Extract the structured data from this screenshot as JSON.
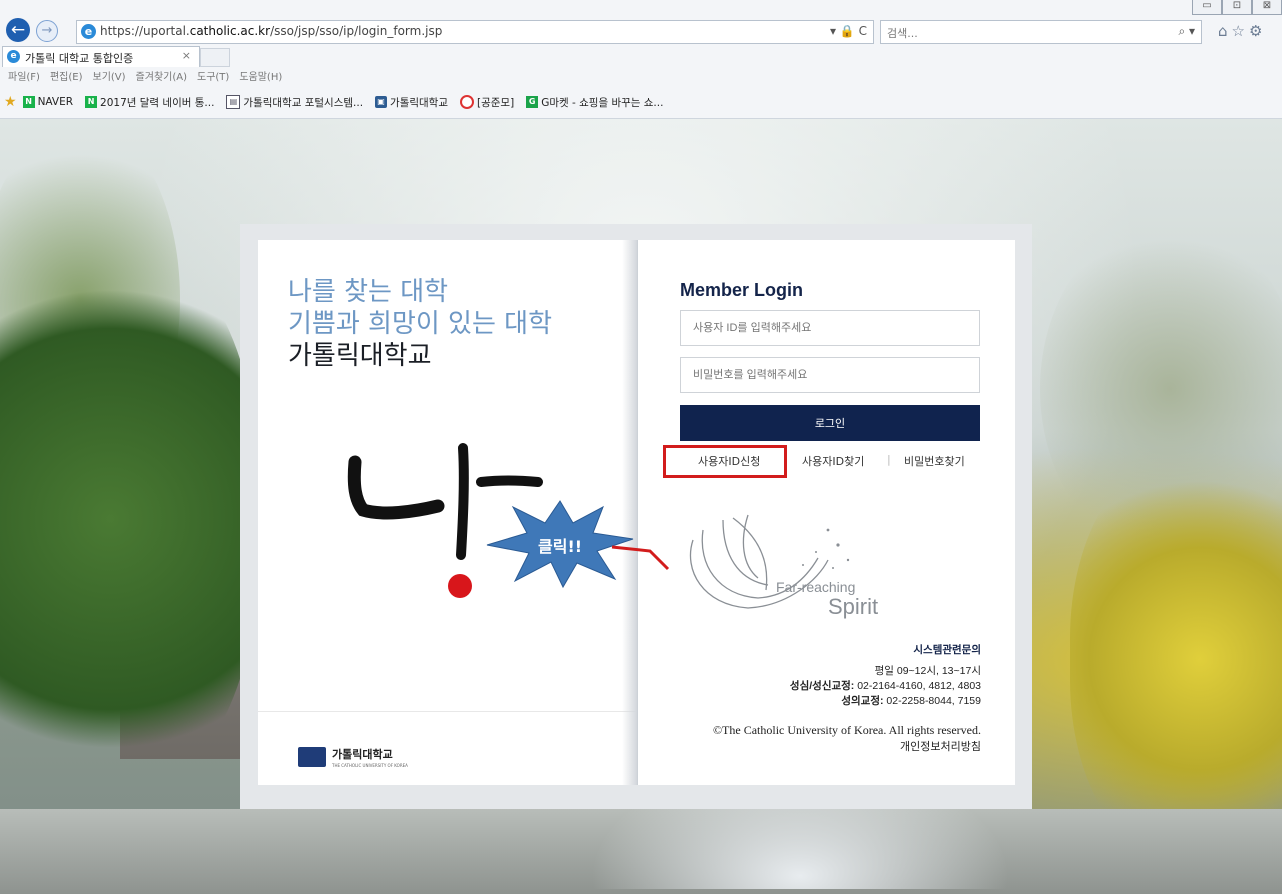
{
  "browser": {
    "url_prefix": "https://uportal.",
    "url_domain": "catholic.ac.kr",
    "url_path": "/sso/jsp/sso/ip/login_form.jsp",
    "address_icons": "▾ 🔒 C",
    "search_placeholder": "검색...",
    "search_icon": "⌕ ▾",
    "right_icons": "⌂☆⚙",
    "tab_title": "가톨릭 대학교 통합인증",
    "tab_close": "×",
    "window_buttons": [
      "▭",
      "⊡",
      "⊠"
    ],
    "menu": [
      "파일(F)",
      "편집(E)",
      "보기(V)",
      "즐겨찾기(A)",
      "도구(T)",
      "도움말(H)"
    ],
    "favorites": [
      {
        "label": "NAVER",
        "icon": "naver-icon"
      },
      {
        "label": "2017년 달력 네이버 통...",
        "icon": "naver-icon"
      },
      {
        "label": "가톨릭대학교 포털시스템...",
        "icon": "portal-icon"
      },
      {
        "label": "가톨릭대학교",
        "icon": "catholic-icon"
      },
      {
        "label": "[공준모]",
        "icon": "gongjunmo-icon"
      },
      {
        "label": "G마켓 - 쇼핑을 바꾸는 쇼...",
        "icon": "gmarket-icon"
      }
    ]
  },
  "left_page": {
    "slogan_line1": "나를 찾는 대학",
    "slogan_line2": "기쁨과 희망이 있는 대학",
    "slogan_line3": "가톨릭대학교",
    "logo_text": "가톨릭대학교",
    "logo_sub": "THE CATHOLIC UNIVERSITY OF KOREA"
  },
  "login": {
    "title": "Member Login",
    "id_placeholder": "사용자 ID를 입력해주세요",
    "pw_placeholder": "비밀번호를 입력해주세요",
    "login_button": "로그인",
    "apply_id": "사용자ID신청",
    "find_id": "사용자ID찾기",
    "separator": "|",
    "find_pw": "비밀번호찾기"
  },
  "spirit": {
    "far": "Far-reaching",
    "word": "Spirit"
  },
  "contact": {
    "title": "시스템관련문의",
    "hours": "평일 09~12시, 13~17시",
    "campus1_label": "성심/성신교정:",
    "campus1_phone": "02-2164-4160, 4812, 4803",
    "campus2_label": "성의교정:",
    "campus2_phone": "02-2258-8044, 7159"
  },
  "footer": {
    "copyright": "©The Catholic University of Korea. All rights reserved.",
    "privacy": "개인정보처리방침"
  },
  "annotation": {
    "label": "클릭!!"
  },
  "colors": {
    "navy": "#10234e",
    "slogan_blue": "#6d97c4",
    "highlight_red": "#d21c1c",
    "burst_blue": "#3f78b8"
  }
}
